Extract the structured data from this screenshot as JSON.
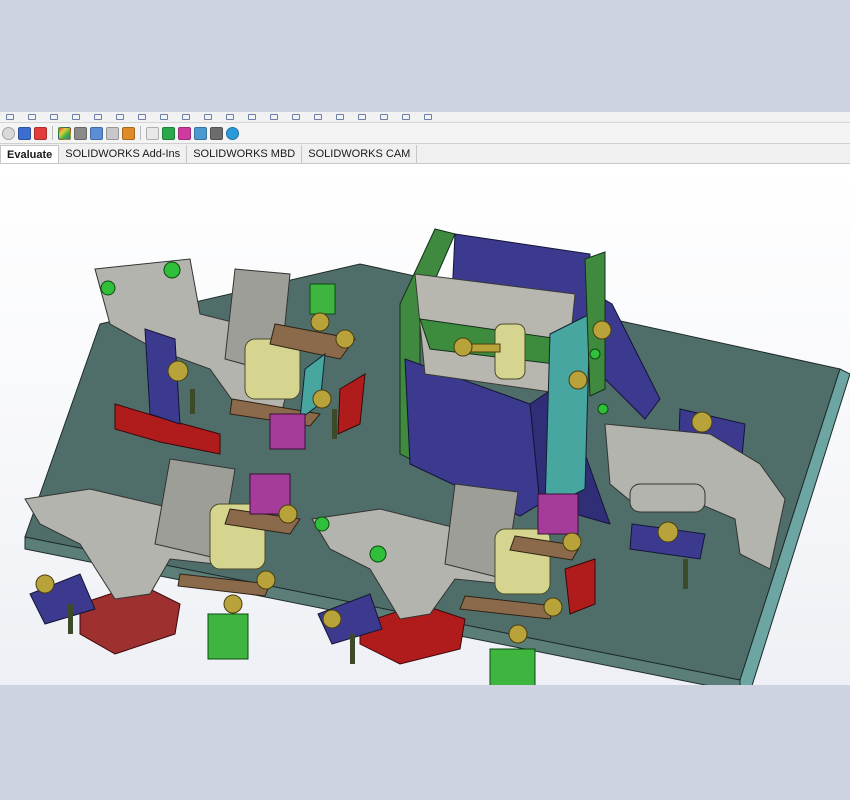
{
  "app": {
    "name": "SOLIDWORKS"
  },
  "command_manager": {
    "tabs": [
      {
        "label": "Evaluate",
        "active": true
      },
      {
        "label": "SOLIDWORKS Add-Ins",
        "active": false
      },
      {
        "label": "SOLIDWORKS MBD",
        "active": false
      },
      {
        "label": "SOLIDWORKS CAM",
        "active": false
      }
    ]
  },
  "toolbar": {
    "icons": [
      "design-checker-icon",
      "interference-detection-icon",
      "measure-icon",
      "appearance-icon",
      "mass-properties-icon",
      "section-properties-icon",
      "check-icon",
      "draft-analysis-icon",
      "undercut-analysis-icon",
      "parting-line-analysis-icon",
      "thickness-analysis-icon",
      "symmetry-check-icon",
      "compare-documents-icon",
      "performance-evaluation-icon"
    ]
  },
  "colors": {
    "background": "#cdd3e1",
    "base_plate": "#4f6e6a",
    "clamp_body": "#b4b4ae",
    "fixture_blue": "#3b3a8f",
    "fixture_green": "#3f8a3f",
    "bolt": "#b8a23a",
    "cylinder": "#d6d58f",
    "link_brown": "#8a6a4a",
    "block_red": "#b01c1c",
    "block_magenta": "#a53c9a",
    "block_lime": "#3eb53e"
  }
}
